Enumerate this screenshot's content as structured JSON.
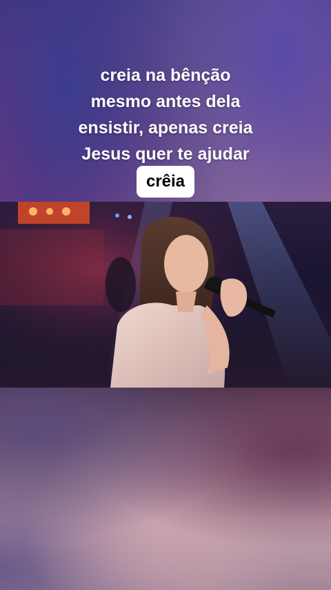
{
  "overlay": {
    "caption_lines": [
      "creia na bênção",
      "mesmo antes dela",
      "ensistir, apenas creia",
      "Jesus quer te ajudar"
    ],
    "highlight_word": "crêia"
  },
  "colors": {
    "caption_text": "#ffffff",
    "highlight_bg": "#ffffff",
    "highlight_text": "#000000"
  }
}
